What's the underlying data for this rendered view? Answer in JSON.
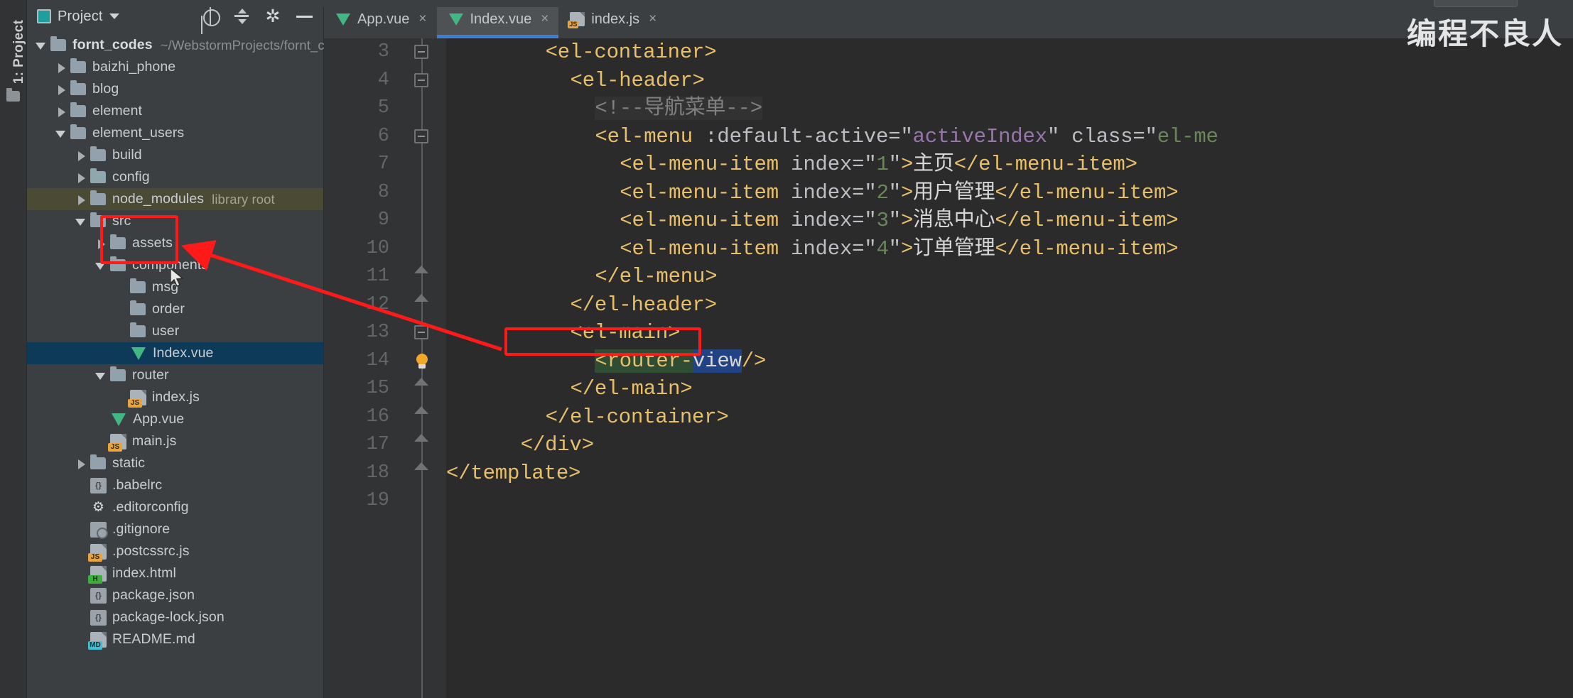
{
  "window": {
    "watermark": "编程不良人"
  },
  "toolwindow": {
    "label": "1: Project",
    "folder_icon": "folder-icon"
  },
  "project_panel": {
    "title": "Project",
    "title_icon": "project-icon",
    "caret_icon": "chevron-down-icon",
    "actions": [
      {
        "name": "locate-icon",
        "glyph": "⊕"
      },
      {
        "name": "collapse-all-icon",
        "glyph": "⇅"
      },
      {
        "name": "gear-icon",
        "glyph": "✱"
      },
      {
        "name": "hide-icon",
        "glyph": "—"
      }
    ]
  },
  "tree": [
    {
      "indent": 0,
      "twisty": "down",
      "icon": "folder",
      "label": "fornt_codes",
      "sub": "~/WebstormProjects/fornt_codes",
      "bold": true
    },
    {
      "indent": 1,
      "twisty": "right",
      "icon": "folder",
      "label": "baizhi_phone",
      "sub": ""
    },
    {
      "indent": 1,
      "twisty": "right",
      "icon": "folder",
      "label": "blog",
      "sub": ""
    },
    {
      "indent": 1,
      "twisty": "right",
      "icon": "folder",
      "label": "element",
      "sub": ""
    },
    {
      "indent": 1,
      "twisty": "down",
      "icon": "folder",
      "label": "element_users",
      "sub": ""
    },
    {
      "indent": 2,
      "twisty": "right",
      "icon": "folder",
      "label": "build",
      "sub": ""
    },
    {
      "indent": 2,
      "twisty": "right",
      "icon": "folder-teal",
      "label": "config",
      "sub": ""
    },
    {
      "indent": 2,
      "twisty": "right",
      "icon": "folder",
      "label": "node_modules",
      "sub": "library root",
      "state": "library"
    },
    {
      "indent": 2,
      "twisty": "down",
      "icon": "folder",
      "label": "src",
      "sub": ""
    },
    {
      "indent": 3,
      "twisty": "right",
      "icon": "folder",
      "label": "assets",
      "sub": ""
    },
    {
      "indent": 3,
      "twisty": "down",
      "icon": "folder",
      "label": "components",
      "sub": ""
    },
    {
      "indent": 4,
      "twisty": "none",
      "icon": "folder",
      "label": "msg",
      "sub": ""
    },
    {
      "indent": 4,
      "twisty": "none",
      "icon": "folder",
      "label": "order",
      "sub": ""
    },
    {
      "indent": 4,
      "twisty": "none",
      "icon": "folder",
      "label": "user",
      "sub": ""
    },
    {
      "indent": 4,
      "twisty": "none",
      "icon": "vue",
      "label": "Index.vue",
      "sub": "",
      "state": "selected"
    },
    {
      "indent": 3,
      "twisty": "down",
      "icon": "folder",
      "label": "router",
      "sub": ""
    },
    {
      "indent": 4,
      "twisty": "none",
      "icon": "js",
      "label": "index.js",
      "sub": ""
    },
    {
      "indent": 3,
      "twisty": "none",
      "icon": "vue",
      "label": "App.vue",
      "sub": ""
    },
    {
      "indent": 3,
      "twisty": "none",
      "icon": "js",
      "label": "main.js",
      "sub": ""
    },
    {
      "indent": 2,
      "twisty": "right",
      "icon": "folder",
      "label": "static",
      "sub": ""
    },
    {
      "indent": 2,
      "twisty": "none",
      "icon": "config",
      "label": ".babelrc",
      "sub": ""
    },
    {
      "indent": 2,
      "twisty": "none",
      "icon": "gear",
      "label": ".editorconfig",
      "sub": ""
    },
    {
      "indent": 2,
      "twisty": "none",
      "icon": "git",
      "label": ".gitignore",
      "sub": ""
    },
    {
      "indent": 2,
      "twisty": "none",
      "icon": "js",
      "label": ".postcssrc.js",
      "sub": ""
    },
    {
      "indent": 2,
      "twisty": "none",
      "icon": "html",
      "label": "index.html",
      "sub": ""
    },
    {
      "indent": 2,
      "twisty": "none",
      "icon": "config",
      "label": "package.json",
      "sub": ""
    },
    {
      "indent": 2,
      "twisty": "none",
      "icon": "config",
      "label": "package-lock.json",
      "sub": ""
    },
    {
      "indent": 2,
      "twisty": "none",
      "icon": "md",
      "label": "README.md",
      "sub": ""
    }
  ],
  "tabs": [
    {
      "label": "App.vue",
      "icon": "vue-file-icon",
      "close": "×",
      "active": false
    },
    {
      "label": "Index.vue",
      "icon": "vue-file-icon",
      "close": "×",
      "active": true
    },
    {
      "label": "index.js",
      "icon": "js-file-icon",
      "close": "×",
      "active": false
    }
  ],
  "editor": {
    "lines": [
      {
        "num": "3",
        "marker": "fold-square",
        "indent": 4,
        "segs": [
          {
            "t": "<el-container>",
            "c": "tag"
          }
        ]
      },
      {
        "num": "4",
        "marker": "fold-square",
        "indent": 5,
        "segs": [
          {
            "t": "<el-header>",
            "c": "tag"
          }
        ]
      },
      {
        "num": "5",
        "marker": "",
        "indent": 6,
        "segs": [
          {
            "t": "<!--导航菜单-->",
            "c": "cmt"
          }
        ]
      },
      {
        "num": "6",
        "marker": "fold-square",
        "indent": 6,
        "segs": [
          {
            "t": "<el-menu",
            "c": "tag"
          },
          {
            "t": " :default-active=",
            "c": "attr"
          },
          {
            "t": "\"",
            "c": "strq"
          },
          {
            "t": "activeIndex",
            "c": "bnd"
          },
          {
            "t": "\"",
            "c": "strq"
          },
          {
            "t": " class=",
            "c": "attr"
          },
          {
            "t": "\"",
            "c": "strq"
          },
          {
            "t": "el-me",
            "c": "str"
          }
        ]
      },
      {
        "num": "7",
        "marker": "",
        "indent": 7,
        "segs": [
          {
            "t": "<el-menu-item",
            "c": "tag"
          },
          {
            "t": " index=",
            "c": "attr"
          },
          {
            "t": "\"",
            "c": "strq"
          },
          {
            "t": "1",
            "c": "str"
          },
          {
            "t": "\"",
            "c": "strq"
          },
          {
            "t": ">",
            "c": "tag"
          },
          {
            "t": "主页",
            "c": "plain"
          },
          {
            "t": "</el-menu-item>",
            "c": "tag"
          }
        ]
      },
      {
        "num": "8",
        "marker": "",
        "indent": 7,
        "segs": [
          {
            "t": "<el-menu-item",
            "c": "tag"
          },
          {
            "t": " index=",
            "c": "attr"
          },
          {
            "t": "\"",
            "c": "strq"
          },
          {
            "t": "2",
            "c": "str"
          },
          {
            "t": "\"",
            "c": "strq"
          },
          {
            "t": ">",
            "c": "tag"
          },
          {
            "t": "用户管理",
            "c": "plain"
          },
          {
            "t": "</el-menu-item>",
            "c": "tag"
          }
        ]
      },
      {
        "num": "9",
        "marker": "",
        "indent": 7,
        "segs": [
          {
            "t": "<el-menu-item",
            "c": "tag"
          },
          {
            "t": " index=",
            "c": "attr"
          },
          {
            "t": "\"",
            "c": "strq"
          },
          {
            "t": "3",
            "c": "str"
          },
          {
            "t": "\"",
            "c": "strq"
          },
          {
            "t": ">",
            "c": "tag"
          },
          {
            "t": "消息中心",
            "c": "plain"
          },
          {
            "t": "</el-menu-item>",
            "c": "tag"
          }
        ]
      },
      {
        "num": "10",
        "marker": "",
        "indent": 7,
        "segs": [
          {
            "t": "<el-menu-item",
            "c": "tag"
          },
          {
            "t": " index=",
            "c": "attr"
          },
          {
            "t": "\"",
            "c": "strq"
          },
          {
            "t": "4",
            "c": "str"
          },
          {
            "t": "\"",
            "c": "strq"
          },
          {
            "t": ">",
            "c": "tag"
          },
          {
            "t": "订单管理",
            "c": "plain"
          },
          {
            "t": "</el-menu-item>",
            "c": "tag"
          }
        ]
      },
      {
        "num": "11",
        "marker": "fold-up",
        "indent": 6,
        "segs": [
          {
            "t": "</el-menu>",
            "c": "tag"
          }
        ]
      },
      {
        "num": "12",
        "marker": "fold-up",
        "indent": 5,
        "segs": [
          {
            "t": "</el-header>",
            "c": "tag"
          }
        ]
      },
      {
        "num": "13",
        "marker": "fold-square",
        "indent": 5,
        "segs": [
          {
            "t": "<el-main>",
            "c": "tag"
          }
        ]
      },
      {
        "num": "14",
        "marker": "bulb",
        "indent": 6,
        "segs": [
          {
            "t": "<router-",
            "c": "tag",
            "hl": "search"
          },
          {
            "t": "view",
            "c": "tag",
            "hl": "sel"
          },
          {
            "t": "/>",
            "c": "tag"
          }
        ],
        "boxed": true
      },
      {
        "num": "15",
        "marker": "fold-up",
        "indent": 5,
        "segs": [
          {
            "t": "</el-main>",
            "c": "tag"
          }
        ]
      },
      {
        "num": "16",
        "marker": "fold-up",
        "indent": 4,
        "segs": [
          {
            "t": "</el-container>",
            "c": "tag"
          }
        ]
      },
      {
        "num": "17",
        "marker": "fold-up",
        "indent": 3,
        "segs": [
          {
            "t": "</div>",
            "c": "tag"
          }
        ]
      },
      {
        "num": "18",
        "marker": "fold-up",
        "indent": 0,
        "segs": [
          {
            "t": "</template>",
            "c": "tag"
          }
        ]
      },
      {
        "num": "19",
        "marker": "",
        "indent": 0,
        "segs": []
      }
    ]
  },
  "annotations": {
    "box_color": "#ff1a1a",
    "folder_box": {
      "label": "components-folders-highlight"
    },
    "router_box": {
      "label": "router-view-highlight"
    },
    "arrow": {
      "label": "red-arrow-pointing-to-folders"
    }
  }
}
